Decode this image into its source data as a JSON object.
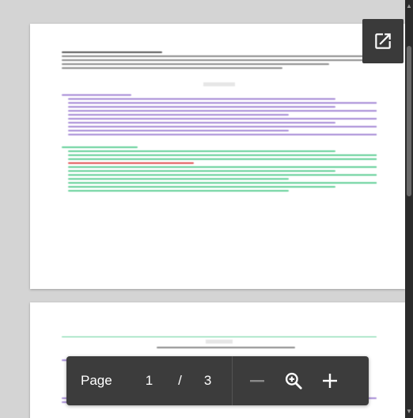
{
  "toolbar": {
    "page_label": "Page",
    "current_page": "1",
    "separator": "/",
    "total_pages": "3"
  },
  "icons": {
    "popout": "open-in-new-icon",
    "zoom_out": "minus-icon",
    "zoom": "magnifier-plus-icon",
    "zoom_in": "plus-icon"
  },
  "colors": {
    "toolbar_bg": "#3c3c3c",
    "viewer_bg": "#d4d4d4",
    "scrollbar": "#2b2b2b"
  }
}
